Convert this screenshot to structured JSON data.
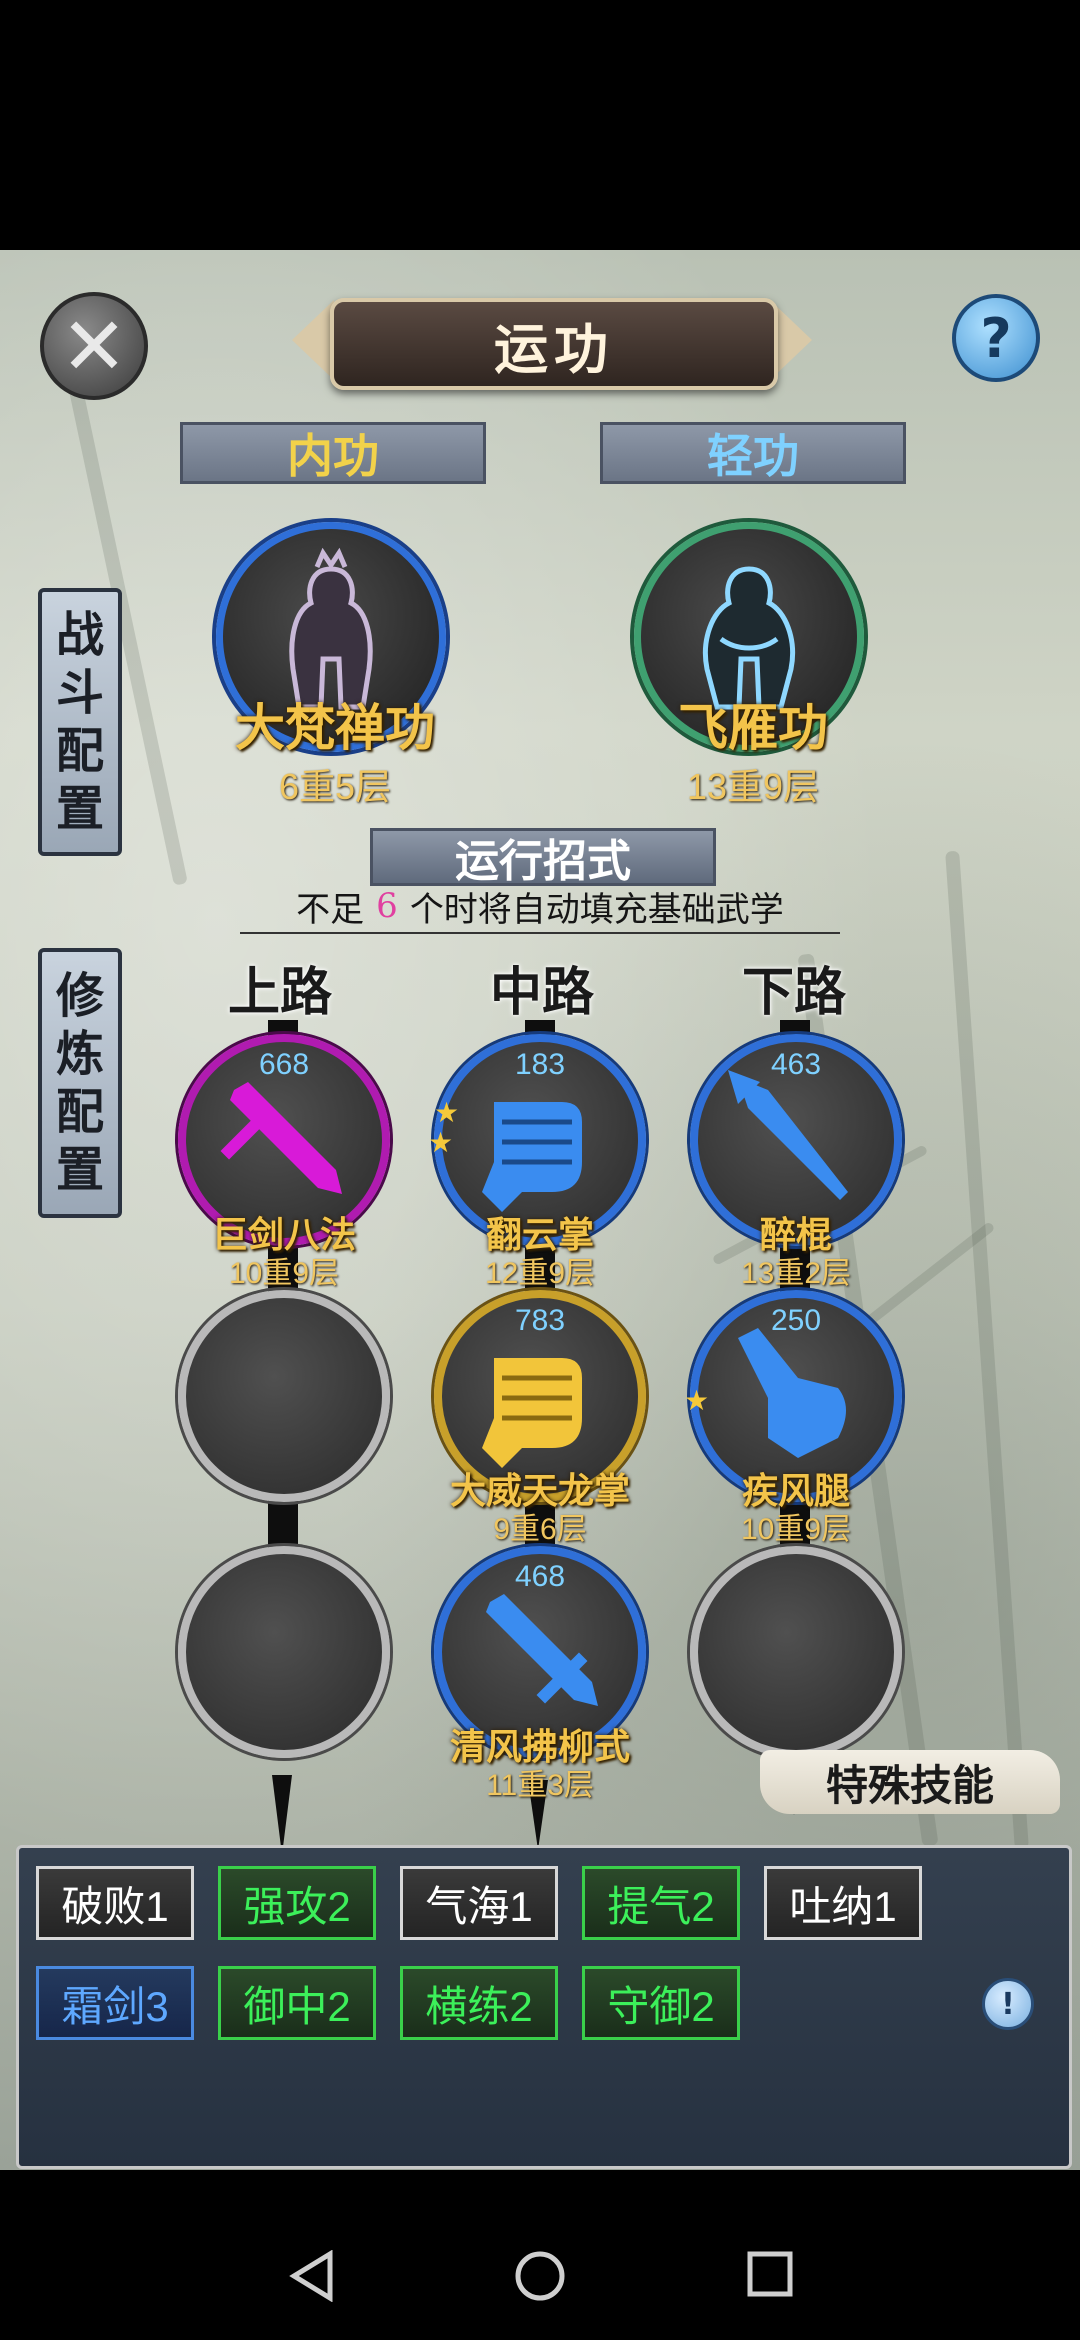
{
  "title": "运功",
  "tabs": {
    "neigong": "内功",
    "qinggong": "轻功"
  },
  "side_buttons": {
    "battle": [
      "战",
      "斗",
      "配",
      "置"
    ],
    "train": [
      "修",
      "炼",
      "配",
      "置"
    ]
  },
  "main_skills": [
    {
      "name": "大梵禅功",
      "level": "6重5层",
      "ring_color": "#2f6fd8"
    },
    {
      "name": "飞雁功",
      "level": "13重9层",
      "ring_color": "#3fa070"
    }
  ],
  "run_moves": {
    "label": "运行招式",
    "hint_prefix": "不足",
    "hint_number": "6",
    "hint_suffix": "个时将自动填充基础武学"
  },
  "columns": [
    "上路",
    "中路",
    "下路"
  ],
  "skills": {
    "top": [
      {
        "count": "668",
        "name": "巨剑八法",
        "level": "10重9层",
        "ring": "#b01bb0",
        "icon": "sword-icon",
        "color": "#d81ad8"
      },
      null,
      null
    ],
    "middle": [
      {
        "count": "183",
        "name": "翻云掌",
        "level": "12重9层",
        "ring": "#2f6fd8",
        "icon": "fist-icon",
        "color": "#3a8cf0",
        "stars": 2
      },
      {
        "count": "783",
        "name": "大威天龙掌",
        "level": "9重6层",
        "ring": "#c8a02a",
        "icon": "fist-icon",
        "color": "#f2c53a"
      },
      {
        "count": "468",
        "name": "清风拂柳式",
        "level": "11重3层",
        "ring": "#2f6fd8",
        "icon": "sword-icon",
        "color": "#3a8cf0"
      }
    ],
    "bottom": [
      {
        "count": "463",
        "name": "醉棍",
        "level": "13重2层",
        "ring": "#2f6fd8",
        "icon": "spear-icon",
        "color": "#3a8cf0"
      },
      {
        "count": "250",
        "name": "疾风腿",
        "level": "10重9层",
        "ring": "#2f6fd8",
        "icon": "pointing-hand-icon",
        "color": "#3a8cf0",
        "stars": 1
      },
      null
    ]
  },
  "special": {
    "label": "特殊技能",
    "chips_row1": [
      {
        "label": "破败1",
        "style": "white"
      },
      {
        "label": "强攻2",
        "style": "green"
      },
      {
        "label": "气海1",
        "style": "white"
      },
      {
        "label": "提气2",
        "style": "green"
      },
      {
        "label": "吐纳1",
        "style": "white"
      }
    ],
    "chips_row2": [
      {
        "label": "霜剑3",
        "style": "blue"
      },
      {
        "label": "御中2",
        "style": "green"
      },
      {
        "label": "横练2",
        "style": "green"
      },
      {
        "label": "守御2",
        "style": "green"
      }
    ]
  },
  "icons": {
    "close": "close-icon",
    "help": "help-icon",
    "tip": "exclamation-icon",
    "nav": [
      "back-icon",
      "home-icon",
      "recent-apps-icon"
    ]
  }
}
